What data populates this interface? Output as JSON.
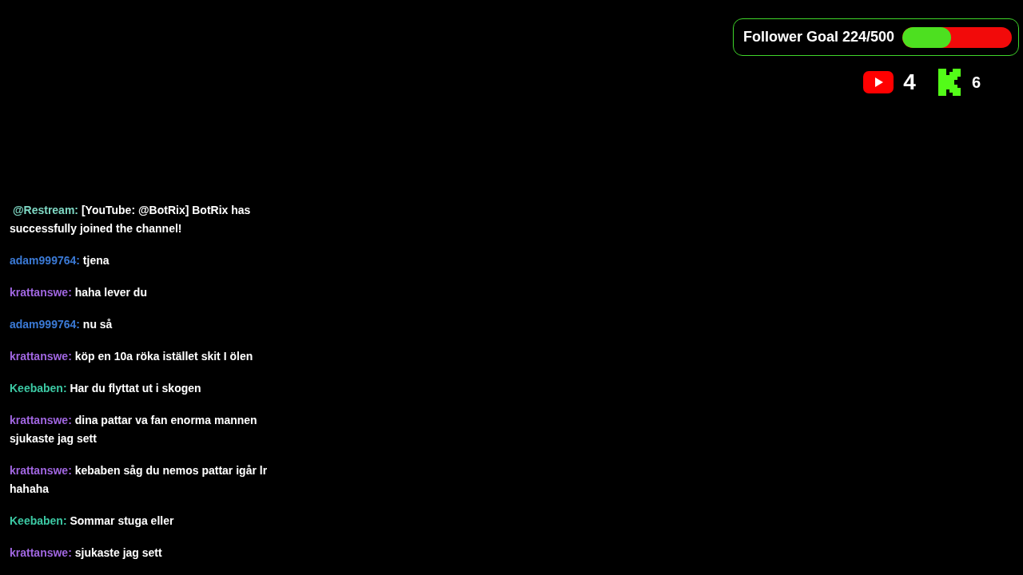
{
  "follower_goal": {
    "label": "Follower Goal 224/500",
    "level": 0.448
  },
  "platforms": [
    {
      "kind": "youtube",
      "count": "4"
    },
    {
      "kind": "kick",
      "count": "6"
    }
  ],
  "chat": [
    {
      "user": " @Restream:",
      "color": "#7fd8c4",
      "text": " [YouTube: @BotRix] BotRix has successfully joined the channel!"
    },
    {
      "user": "adam999764:",
      "color": "#3b7ad6",
      "text": " tjena"
    },
    {
      "user": "krattanswe:",
      "color": "#a066e0",
      "text": " haha lever du"
    },
    {
      "user": "adam999764:",
      "color": "#3b7ad6",
      "text": " nu så"
    },
    {
      "user": "krattanswe:",
      "color": "#a066e0",
      "text": " köp en 10a röka istället skit I ölen"
    },
    {
      "user": "Keebaben:",
      "color": "#3cc9a4",
      "text": " Har du flyttat ut i skogen"
    },
    {
      "user": "krattanswe:",
      "color": "#a066e0",
      "text": " dina pattar va fan enorma mannen sjukaste jag sett"
    },
    {
      "user": "krattanswe:",
      "color": "#a066e0",
      "text": " kebaben såg du nemos pattar igår lr hahaha"
    },
    {
      "user": "Keebaben:",
      "color": "#3cc9a4",
      "text": " Sommar stuga eller"
    },
    {
      "user": "krattanswe:",
      "color": "#a066e0",
      "text": " sjukaste jag sett"
    }
  ]
}
